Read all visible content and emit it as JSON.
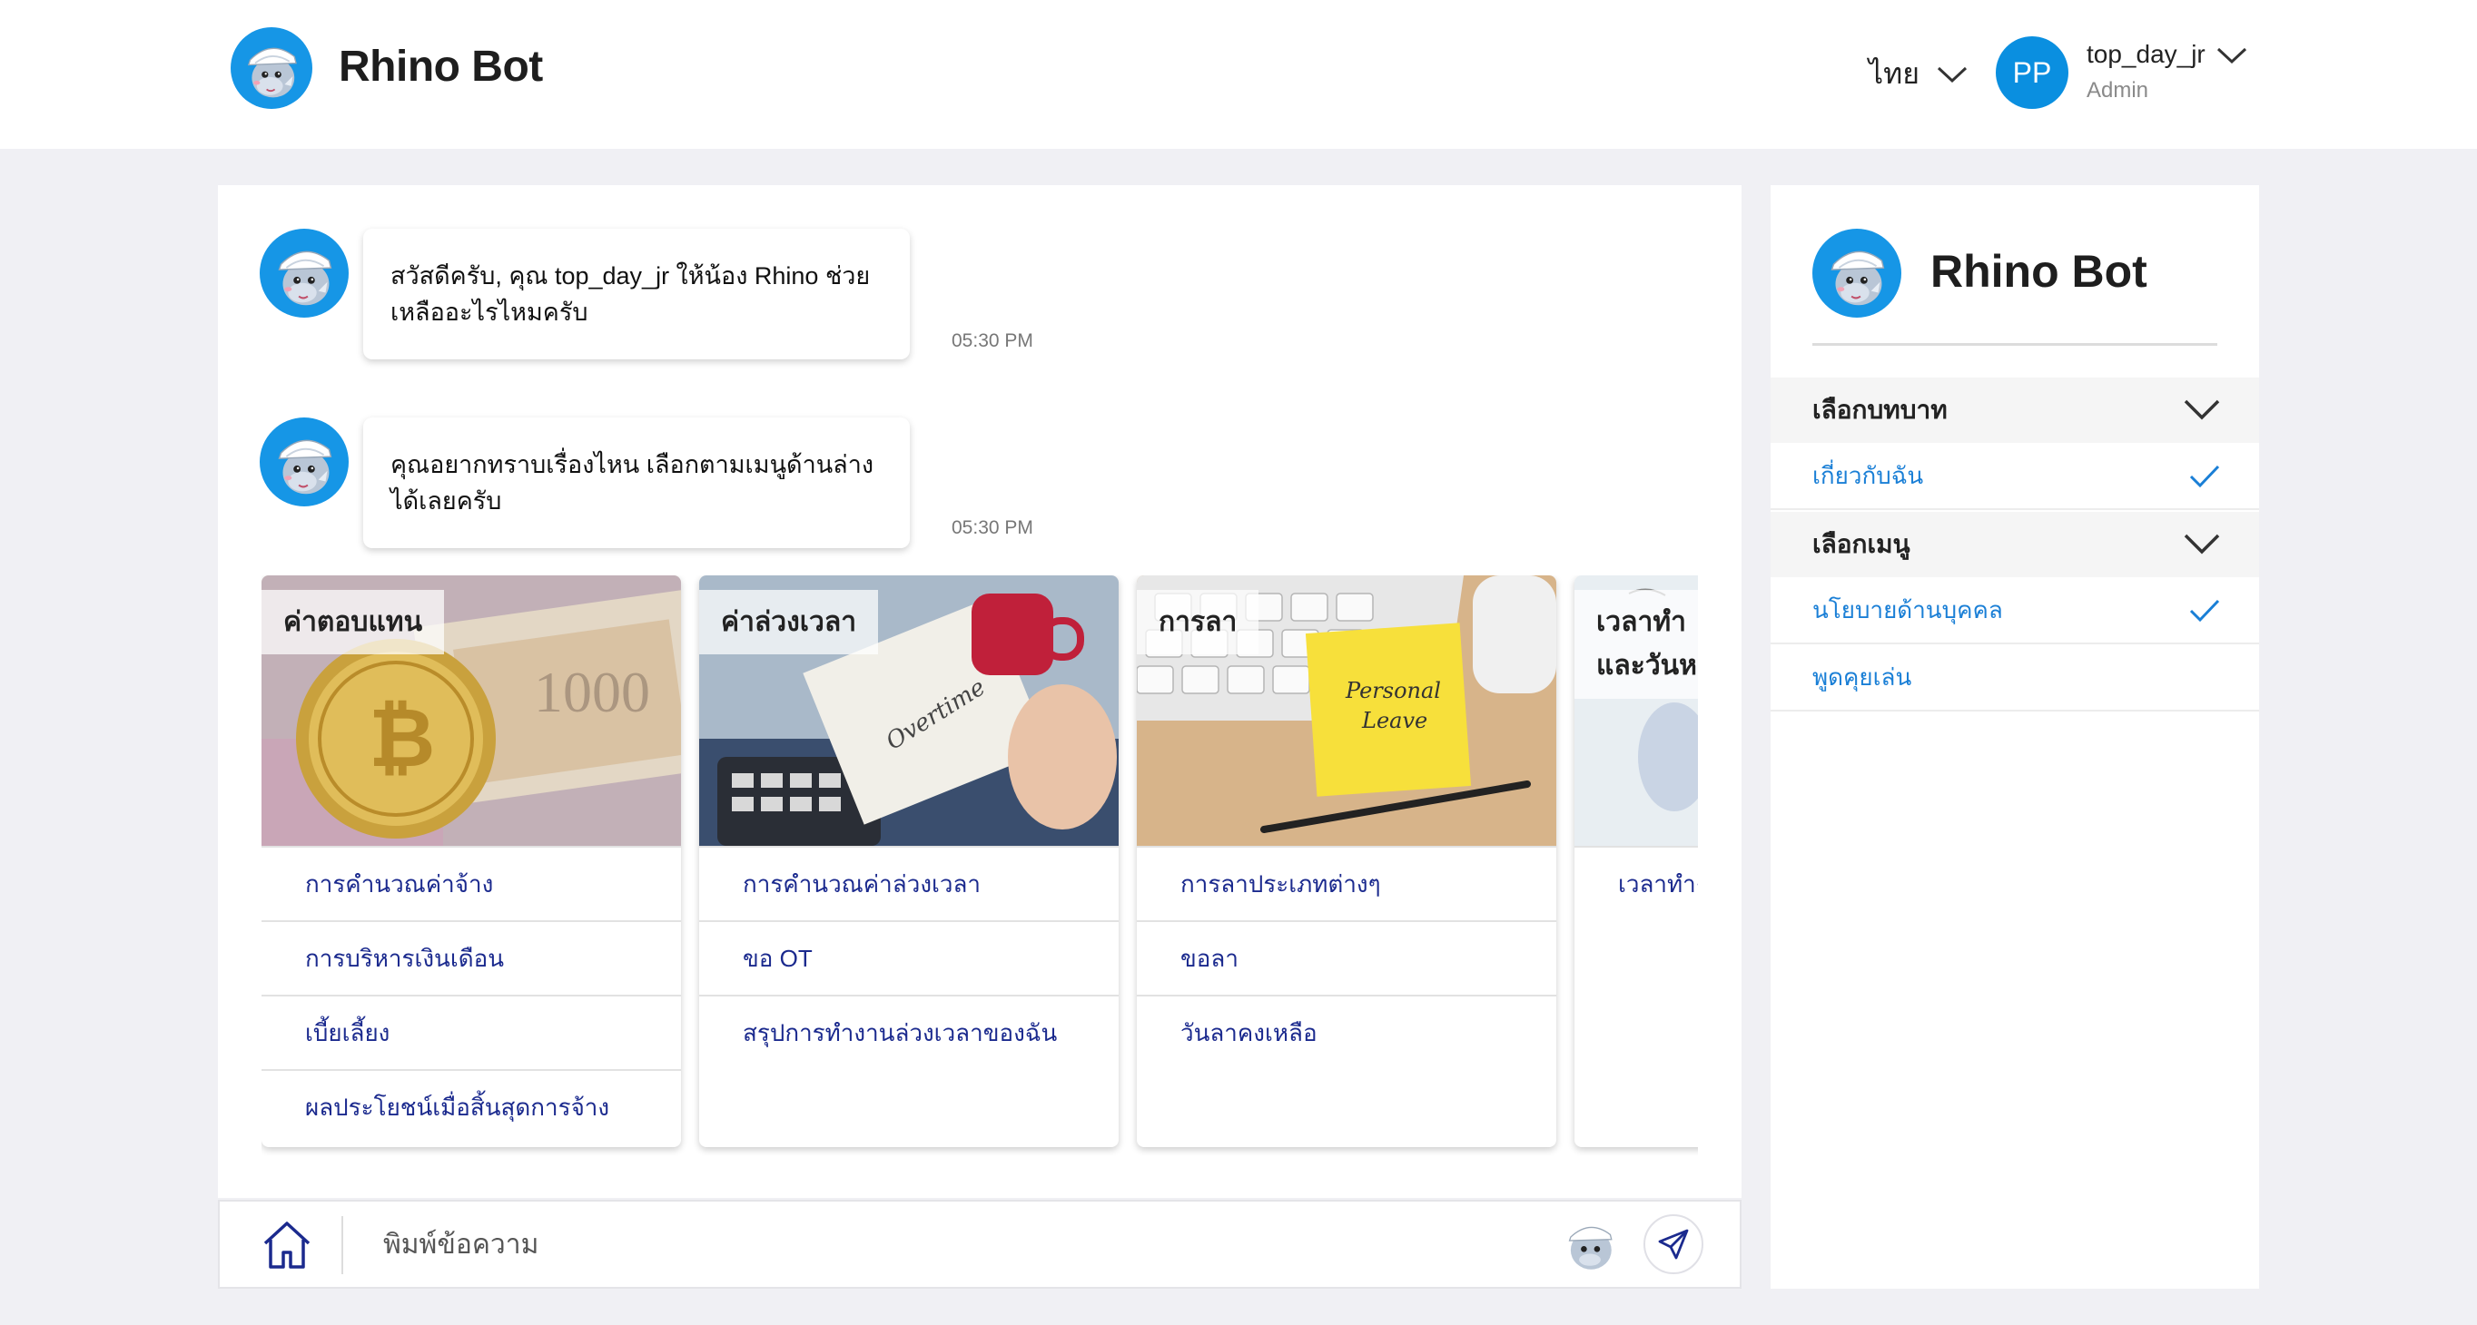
{
  "header": {
    "app_title": "Rhino Bot",
    "language": "ไทย",
    "user": {
      "initials": "PP",
      "name": "top_day_jr",
      "role": "Admin"
    }
  },
  "chat": {
    "messages": [
      {
        "text": "สวัสดีครับ, คุณ top_day_jr ให้น้อง Rhino ช่วยเหลืออะไรไหมครับ",
        "time": "05:30 PM"
      },
      {
        "text": "คุณอยากทราบเรื่องไหน เลือกตามเมนูด้านล่างได้เลยครับ",
        "time": "05:30 PM"
      }
    ],
    "cards": [
      {
        "label": "ค่าตอบแทน",
        "items": [
          "การคำนวณค่าจ้าง",
          "การบริหารเงินเดือน",
          "เบี้ยเลี้ยง",
          "ผลประโยชน์เมื่อสิ้นสุดการจ้าง"
        ]
      },
      {
        "label": "ค่าล่วงเวลา",
        "image_text": "Overtime",
        "items": [
          "การคำนวณค่าล่วงเวลา",
          "ขอ OT",
          "สรุปการทำงานล่วงเวลาของฉัน"
        ]
      },
      {
        "label": "การลา",
        "image_text_1": "Personal",
        "image_text_2": "Leave",
        "items": [
          "การลาประเภทต่างๆ",
          "ขอลา",
          "วันลาคงเหลือ"
        ]
      },
      {
        "label_line1": "เวลาทำ",
        "label_line2": "และวันห",
        "items": [
          "เวลาทำง"
        ]
      }
    ],
    "input_placeholder": "พิมพ์ข้อความ"
  },
  "sidebar": {
    "title": "Rhino Bot",
    "sections": [
      {
        "heading": "เลือกบทบาท",
        "items": [
          {
            "label": "เกี่ยวกับฉัน",
            "selected": true
          }
        ]
      },
      {
        "heading": "เลือกเมนู",
        "items": [
          {
            "label": "นโยบายด้านบุคคล",
            "selected": true
          },
          {
            "label": "พูดคุยเล่น",
            "selected": false
          }
        ]
      }
    ]
  },
  "colors": {
    "accent_blue": "#0a8fe0",
    "link_blue": "#1a7fd6",
    "card_item_text": "#1b2a8e"
  },
  "icons": [
    "rhino-bot-logo",
    "chevron-down-icon",
    "home-icon",
    "send-icon",
    "check-icon"
  ]
}
